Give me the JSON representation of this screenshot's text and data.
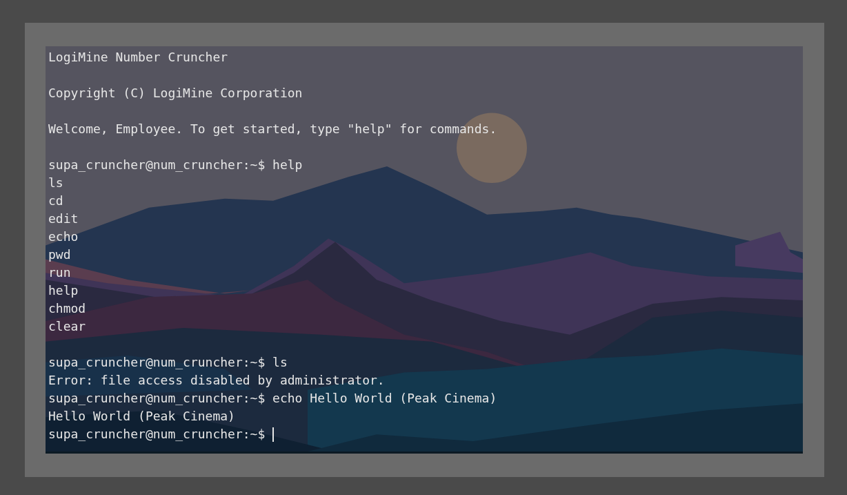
{
  "terminal": {
    "blocks": [
      [
        "LogiMine Number Cruncher"
      ],
      [
        "Copyright (C) LogiMine Corporation"
      ],
      [
        "Welcome, Employee. To get started, type \"help\" for commands."
      ],
      [
        "supa_cruncher@num_cruncher:~$ help",
        "ls",
        "cd",
        "edit",
        "echo",
        "pwd",
        "run",
        "help",
        "chmod",
        "clear"
      ],
      [
        "supa_cruncher@num_cruncher:~$ ls",
        "Error: file access disabled by administrator.",
        "supa_cruncher@num_cruncher:~$ echo Hello World (Peak Cinema)",
        "Hello World (Peak Cinema)"
      ]
    ],
    "input_line": {
      "prompt": "supa_cruncher@num_cruncher:~$",
      "cursor": true
    },
    "background": {
      "kind": "picture"
    }
  }
}
